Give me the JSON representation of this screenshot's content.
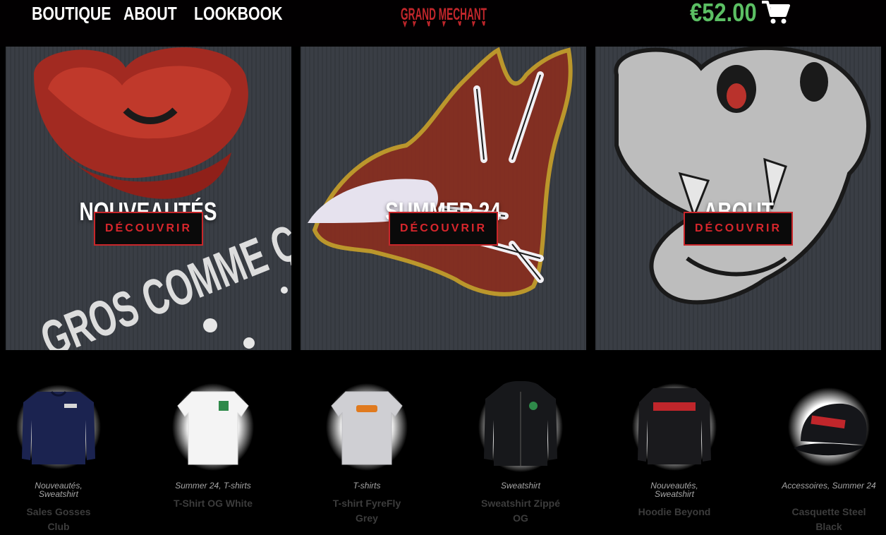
{
  "header": {
    "nav": [
      "BOUTIQUE",
      "ABOUT",
      "LOOKBOOK"
    ],
    "logo_text": "GRAND MECHANT",
    "cart_total": "€52.00",
    "cart_icon": "shopping-cart-icon"
  },
  "tiles": [
    {
      "title": "NOUVEAUTÉS",
      "button": "DÉCOUVRIR",
      "art_text": "GROS COMME ÇA"
    },
    {
      "title": "SUMMER 24",
      "button": "DÉCOUVRIR"
    },
    {
      "title": "ABOUT",
      "button": "DÉCOUVRIR"
    }
  ],
  "products": [
    {
      "cats": [
        "Nouveautés",
        "Sweatshirt"
      ],
      "name_lines": [
        "Sales Gosses",
        "Club"
      ]
    },
    {
      "cats": [
        "Summer 24",
        "T-shirts"
      ],
      "name_lines": [
        "T-Shirt OG White"
      ]
    },
    {
      "cats": [
        "T-shirts"
      ],
      "name_lines": [
        "T-shirt FyreFly",
        "Grey"
      ]
    },
    {
      "cats": [
        "Sweatshirt"
      ],
      "name_lines": [
        "Sweatshirt Zippé",
        "OG"
      ]
    },
    {
      "cats": [
        "Nouveautés",
        "Sweatshirt"
      ],
      "name_lines": [
        "Hoodie Beyond"
      ]
    },
    {
      "cats": [
        "Accessoires",
        "Summer 24"
      ],
      "name_lines": [
        "Casquette Steel",
        "Black"
      ]
    }
  ],
  "colors": {
    "accent_red": "#d8262c",
    "cart_green": "#5bbf63",
    "background": "#000000"
  }
}
